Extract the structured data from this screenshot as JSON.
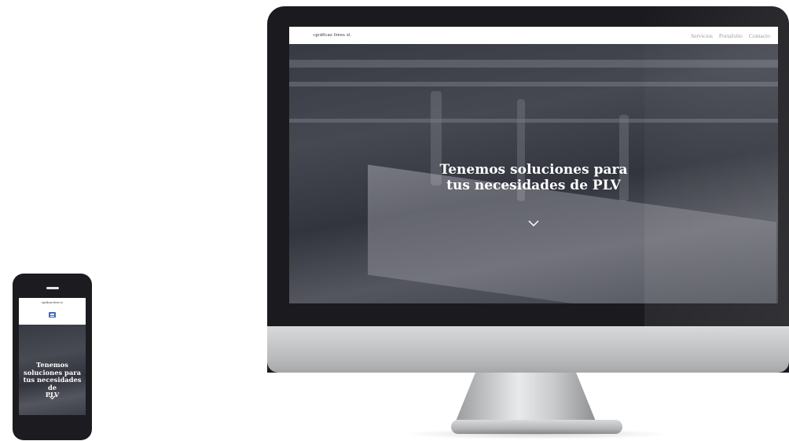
{
  "desktop": {
    "logo": "«gráficas limes sl.",
    "nav": [
      "Servicios",
      "Portafolio",
      "Contacto"
    ],
    "hero_title_lines": [
      "Tenemos soluciones para",
      "tus necesidades de PLV"
    ],
    "scroll_icon": "chevron-down-icon"
  },
  "mobile": {
    "logo": "«gráficas limes sl.",
    "menu_icon": "hamburger-menu-icon",
    "hero_title_lines": [
      "Tenemos",
      "soluciones para",
      "tus necesidades de",
      "PLV"
    ],
    "scroll_icon": "chevron-down-icon"
  },
  "colors": {
    "menu_button": "#3d66c4",
    "hero_overlay": "#282a37",
    "device_frame": "#1b1b1f"
  }
}
